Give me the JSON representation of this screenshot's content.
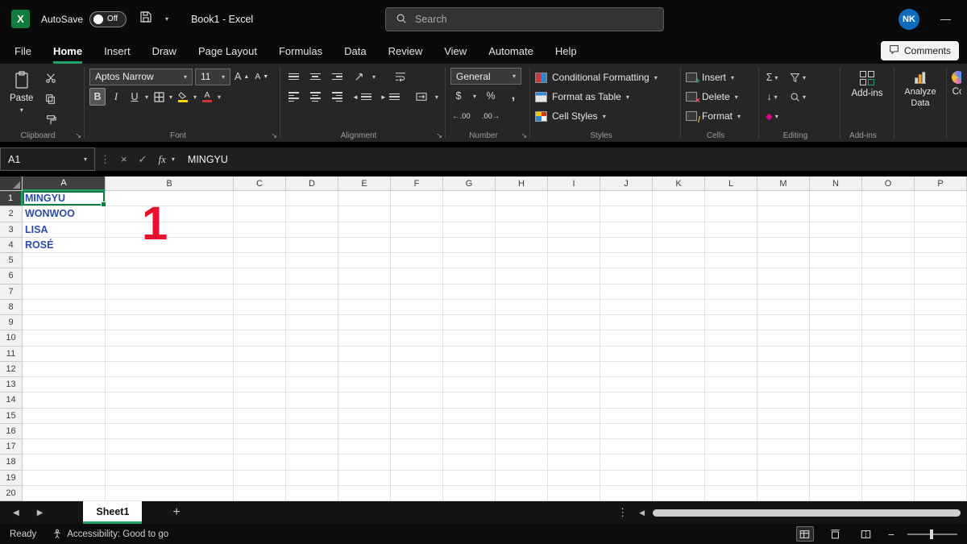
{
  "colors": {
    "accent_green": "#21a366",
    "excel_green": "#107c41",
    "cell_text_blue": "#2b4bad",
    "annotation_red": "#e8112d",
    "avatar_blue": "#0f6cbd"
  },
  "titlebar": {
    "autosave_label": "AutoSave",
    "autosave_state": "Off",
    "doc_title": "Book1 - Excel",
    "search_placeholder": "Search",
    "avatar_initials": "NK",
    "minimize_glyph": "—"
  },
  "menubar": {
    "items": [
      "File",
      "Home",
      "Insert",
      "Draw",
      "Page Layout",
      "Formulas",
      "Data",
      "Review",
      "View",
      "Automate",
      "Help"
    ],
    "active": "Home",
    "comments_label": "Comments"
  },
  "ribbon": {
    "clipboard": {
      "paste_label": "Paste",
      "group_label": "Clipboard"
    },
    "font": {
      "font_name": "Aptos Narrow",
      "font_size": "11",
      "bold": "B",
      "italic": "I",
      "underline": "U",
      "group_label": "Font"
    },
    "alignment": {
      "group_label": "Alignment"
    },
    "number": {
      "format": "General",
      "currency": "$",
      "percent": "%",
      "comma": ",",
      "inc_decimal": "←.00",
      "dec_decimal": ".00→",
      "group_label": "Number"
    },
    "styles": {
      "items": [
        "Conditional Formatting",
        "Format as Table",
        "Cell Styles"
      ],
      "group_label": "Styles"
    },
    "cells": {
      "items": [
        "Insert",
        "Delete",
        "Format"
      ],
      "group_label": "Cells"
    },
    "editing": {
      "autosum": "Σ",
      "group_label": "Editing"
    },
    "addins": {
      "button_label": "Add-ins",
      "group_label": "Add-ins"
    },
    "analyze": {
      "label": "Analyze Data"
    },
    "copilot": {
      "label": "Co"
    }
  },
  "formula_bar": {
    "name_box": "A1",
    "fx_label": "fx",
    "content": "MINGYU"
  },
  "sheet": {
    "columns": [
      "A",
      "B",
      "C",
      "D",
      "E",
      "F",
      "G",
      "H",
      "I",
      "J",
      "K",
      "L",
      "M",
      "N",
      "O",
      "P"
    ],
    "rows": [
      "1",
      "2",
      "3",
      "4",
      "5",
      "6",
      "7",
      "8",
      "9",
      "10",
      "11",
      "12",
      "13",
      "14",
      "15",
      "16",
      "17",
      "18",
      "19",
      "20"
    ],
    "active_cell": "A1",
    "cells": {
      "A1": "MINGYU",
      "A2": "WONWOO",
      "A3": "LISA",
      "A4": "ROSÉ"
    },
    "annotation": "1"
  },
  "tabs": {
    "sheet_name": "Sheet1"
  },
  "statusbar": {
    "ready": "Ready",
    "accessibility": "Accessibility: Good to go"
  }
}
